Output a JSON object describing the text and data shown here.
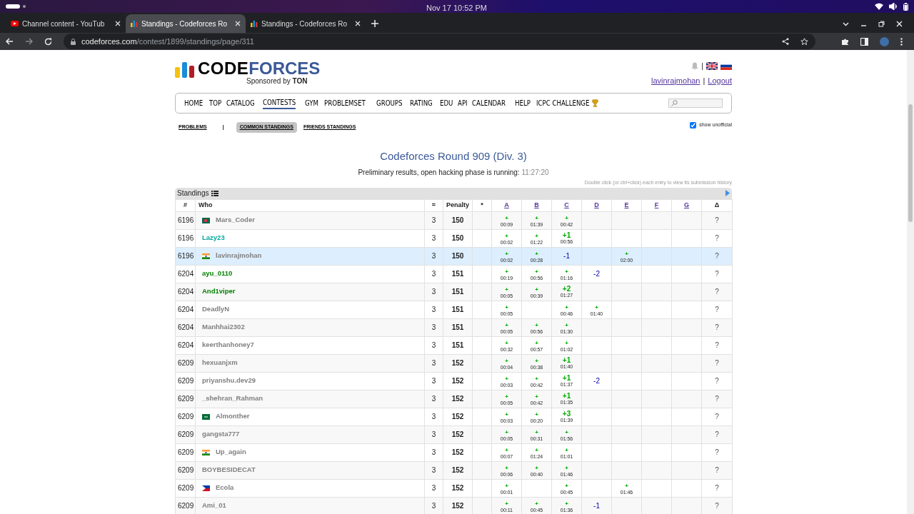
{
  "os_bar": {
    "date_time": "Nov 17  10:52 PM"
  },
  "browser": {
    "tabs": [
      {
        "title": "Channel content - YouTub",
        "kind": "youtube",
        "selected": false
      },
      {
        "title": "Standings - Codeforces Ro",
        "kind": "codeforces",
        "selected": true
      },
      {
        "title": "Standings - Codeforces Ro",
        "kind": "codeforces",
        "selected": false
      }
    ],
    "url_host": "codeforces.com",
    "url_path": "/contest/1899/standings/page/311"
  },
  "header": {
    "logo_first": "CODE",
    "logo_second": "FORCES",
    "sponsor": "Sponsored by **TON**",
    "separator": "|",
    "user": "lavinrajmohan",
    "user_separator": "|",
    "logout": "Logout"
  },
  "nav": [
    {
      "label": "HOME",
      "selected": false
    },
    {
      "label": "TOP",
      "selected": false
    },
    {
      "label": "CATALOG",
      "selected": false
    },
    {
      "label": "CONTESTS",
      "selected": true
    },
    {
      "label": "GYM",
      "selected": false
    },
    {
      "label": "PROBLEMSET",
      "selected": false
    },
    {
      "label": "GROUPS",
      "selected": false
    },
    {
      "label": "RATING",
      "selected": false
    },
    {
      "label": "EDU",
      "selected": false
    },
    {
      "label": "API",
      "selected": false
    },
    {
      "label": "CALENDAR",
      "selected": false
    },
    {
      "label": "HELP",
      "selected": false
    },
    {
      "label": "ICPC CHALLENGE",
      "selected": false,
      "trophy": true
    }
  ],
  "subnav": [
    {
      "label": "PROBLEMS",
      "selected": false
    },
    {
      "label": "COMMON STANDINGS",
      "selected": true
    },
    {
      "label": "FRIENDS STANDINGS",
      "selected": false
    }
  ],
  "subnav_separator": "|",
  "show_unofficial": {
    "label": "show unofficial",
    "checked": true
  },
  "title": "Codeforces Round 909 (Div. 3)",
  "status": {
    "text": "Preliminary results, open hacking phase is running:",
    "timer": "11:27:20"
  },
  "hint": "Double click (or ctrl+click) each entry to view its submission history",
  "table": {
    "caption": "Standings",
    "columns": [
      "#",
      "Who",
      "=",
      "Penalty",
      "*"
    ],
    "problems": [
      "A",
      "B",
      "C",
      "D",
      "E",
      "F",
      "G"
    ],
    "last_column": "Δ",
    "rows": [
      {
        "rank": "6196",
        "flag": {
          "kind": "bd"
        },
        "handle": "Mars_Coder",
        "color": "#808080",
        "solved": "3",
        "penalty": "150",
        "highlighted": false,
        "cells": [
          {
            "kind": "accepted",
            "mark": "+",
            "time": "00:09"
          },
          {
            "kind": "accepted",
            "mark": "+",
            "time": "01:39"
          },
          {
            "kind": "accepted",
            "mark": "+",
            "time": "00:42"
          },
          null,
          null,
          null,
          null
        ],
        "delta": "?"
      },
      {
        "rank": "6196",
        "handle": "Lazy23",
        "color": "#03a89e",
        "solved": "3",
        "penalty": "150",
        "highlighted": false,
        "cells": [
          {
            "kind": "accepted",
            "mark": "+",
            "time": "00:02"
          },
          {
            "kind": "accepted",
            "mark": "+",
            "time": "01:22"
          },
          {
            "kind": "accepted",
            "mark": "+1",
            "time": "00:56"
          },
          null,
          null,
          null,
          null
        ],
        "delta": "?"
      },
      {
        "rank": "6196",
        "flag": {
          "kind": "in"
        },
        "handle": "lavinrajmohan",
        "color": "#808080",
        "solved": "3",
        "penalty": "150",
        "highlighted": true,
        "cells": [
          {
            "kind": "accepted",
            "mark": "+",
            "time": "00:02"
          },
          {
            "kind": "accepted",
            "mark": "+",
            "time": "00:28"
          },
          {
            "kind": "rejected",
            "mark": "-1"
          },
          null,
          {
            "kind": "accepted",
            "mark": "+",
            "time": "02:00"
          },
          null,
          null
        ],
        "delta": "?"
      },
      {
        "rank": "6204",
        "handle": "ayu_0110",
        "color": "#008000",
        "solved": "3",
        "penalty": "151",
        "highlighted": false,
        "cells": [
          {
            "kind": "accepted",
            "mark": "+",
            "time": "00:19"
          },
          {
            "kind": "accepted",
            "mark": "+",
            "time": "00:56"
          },
          {
            "kind": "accepted",
            "mark": "+",
            "time": "01:16"
          },
          {
            "kind": "rejected",
            "mark": "-2"
          },
          null,
          null,
          null
        ],
        "delta": "?"
      },
      {
        "rank": "6204",
        "handle": "And1viper",
        "color": "#008000",
        "solved": "3",
        "penalty": "151",
        "highlighted": false,
        "cells": [
          {
            "kind": "accepted",
            "mark": "+",
            "time": "00:05"
          },
          {
            "kind": "accepted",
            "mark": "+",
            "time": "00:39"
          },
          {
            "kind": "accepted",
            "mark": "+2",
            "time": "01:27"
          },
          null,
          null,
          null,
          null
        ],
        "delta": "?"
      },
      {
        "rank": "6204",
        "handle": "DeadlyN",
        "color": "#808080",
        "solved": "3",
        "penalty": "151",
        "highlighted": false,
        "cells": [
          {
            "kind": "accepted",
            "mark": "+",
            "time": "00:05"
          },
          null,
          {
            "kind": "accepted",
            "mark": "+",
            "time": "00:46"
          },
          {
            "kind": "accepted",
            "mark": "+",
            "time": "01:40"
          },
          null,
          null,
          null
        ],
        "delta": "?"
      },
      {
        "rank": "6204",
        "handle": "Manhhai2302",
        "color": "#808080",
        "solved": "3",
        "penalty": "151",
        "highlighted": false,
        "cells": [
          {
            "kind": "accepted",
            "mark": "+",
            "time": "00:05"
          },
          {
            "kind": "accepted",
            "mark": "+",
            "time": "00:56"
          },
          {
            "kind": "accepted",
            "mark": "+",
            "time": "01:30"
          },
          null,
          null,
          null,
          null
        ],
        "delta": "?"
      },
      {
        "rank": "6204",
        "handle": "keerthanhoney7",
        "color": "#808080",
        "solved": "3",
        "penalty": "151",
        "highlighted": false,
        "cells": [
          {
            "kind": "accepted",
            "mark": "+",
            "time": "00:32"
          },
          {
            "kind": "accepted",
            "mark": "+",
            "time": "00:57"
          },
          {
            "kind": "accepted",
            "mark": "+",
            "time": "01:02"
          },
          null,
          null,
          null,
          null
        ],
        "delta": "?"
      },
      {
        "rank": "6209",
        "handle": "hexuanjxm",
        "color": "#808080",
        "solved": "3",
        "penalty": "152",
        "highlighted": false,
        "cells": [
          {
            "kind": "accepted",
            "mark": "+",
            "time": "00:04"
          },
          {
            "kind": "accepted",
            "mark": "+",
            "time": "00:38"
          },
          {
            "kind": "accepted",
            "mark": "+1",
            "time": "01:40"
          },
          null,
          null,
          null,
          null
        ],
        "delta": "?"
      },
      {
        "rank": "6209",
        "handle": "priyanshu.dev29",
        "color": "#808080",
        "solved": "3",
        "penalty": "152",
        "highlighted": false,
        "cells": [
          {
            "kind": "accepted",
            "mark": "+",
            "time": "00:03"
          },
          {
            "kind": "accepted",
            "mark": "+",
            "time": "00:42"
          },
          {
            "kind": "accepted",
            "mark": "+1",
            "time": "01:37"
          },
          {
            "kind": "rejected",
            "mark": "-2"
          },
          null,
          null,
          null
        ],
        "delta": "?"
      },
      {
        "rank": "6209",
        "handle": "_shehran_Rahman",
        "color": "#808080",
        "solved": "3",
        "penalty": "152",
        "highlighted": false,
        "cells": [
          {
            "kind": "accepted",
            "mark": "+",
            "time": "00:05"
          },
          {
            "kind": "accepted",
            "mark": "+",
            "time": "00:42"
          },
          {
            "kind": "accepted",
            "mark": "+1",
            "time": "01:35"
          },
          null,
          null,
          null,
          null
        ],
        "delta": "?"
      },
      {
        "rank": "6209",
        "flag": {
          "kind": "sa"
        },
        "handle": "Almonther",
        "color": "#808080",
        "solved": "3",
        "penalty": "152",
        "highlighted": false,
        "cells": [
          {
            "kind": "accepted",
            "mark": "+",
            "time": "00:03"
          },
          {
            "kind": "accepted",
            "mark": "+",
            "time": "00:20"
          },
          {
            "kind": "accepted",
            "mark": "+3",
            "time": "01:39"
          },
          null,
          null,
          null,
          null
        ],
        "delta": "?"
      },
      {
        "rank": "6209",
        "handle": "gangsta777",
        "color": "#808080",
        "solved": "3",
        "penalty": "152",
        "highlighted": false,
        "cells": [
          {
            "kind": "accepted",
            "mark": "+",
            "time": "00:05"
          },
          {
            "kind": "accepted",
            "mark": "+",
            "time": "00:31"
          },
          {
            "kind": "accepted",
            "mark": "+",
            "time": "01:56"
          },
          null,
          null,
          null,
          null
        ],
        "delta": "?"
      },
      {
        "rank": "6209",
        "flag": {
          "kind": "in"
        },
        "handle": "Up_again",
        "color": "#808080",
        "solved": "3",
        "penalty": "152",
        "highlighted": false,
        "cells": [
          {
            "kind": "accepted",
            "mark": "+",
            "time": "00:07"
          },
          {
            "kind": "accepted",
            "mark": "+",
            "time": "01:24"
          },
          {
            "kind": "accepted",
            "mark": "+",
            "time": "01:01"
          },
          null,
          null,
          null,
          null
        ],
        "delta": "?"
      },
      {
        "rank": "6209",
        "handle": "BOYBESIDECAT",
        "color": "#808080",
        "solved": "3",
        "penalty": "152",
        "highlighted": false,
        "cells": [
          {
            "kind": "accepted",
            "mark": "+",
            "time": "00:06"
          },
          {
            "kind": "accepted",
            "mark": "+",
            "time": "00:40"
          },
          {
            "kind": "accepted",
            "mark": "+",
            "time": "01:46"
          },
          null,
          null,
          null,
          null
        ],
        "delta": "?"
      },
      {
        "rank": "6209",
        "flag": {
          "kind": "ph"
        },
        "handle": "Ecola",
        "color": "#808080",
        "solved": "3",
        "penalty": "152",
        "highlighted": false,
        "cells": [
          {
            "kind": "accepted",
            "mark": "+",
            "time": "00:01"
          },
          null,
          {
            "kind": "accepted",
            "mark": "+",
            "time": "00:45"
          },
          null,
          {
            "kind": "accepted",
            "mark": "+",
            "time": "01:46"
          },
          null,
          null
        ],
        "delta": "?"
      },
      {
        "rank": "6209",
        "handle": "Ami_01",
        "color": "#808080",
        "solved": "3",
        "penalty": "152",
        "highlighted": false,
        "cells": [
          {
            "kind": "accepted",
            "mark": "+",
            "time": "00:11"
          },
          {
            "kind": "accepted",
            "mark": "+",
            "time": "00:45"
          },
          {
            "kind": "accepted",
            "mark": "+",
            "time": "01:36"
          },
          {
            "kind": "rejected",
            "mark": "-1"
          },
          null,
          null,
          null
        ],
        "delta": "?"
      }
    ]
  }
}
